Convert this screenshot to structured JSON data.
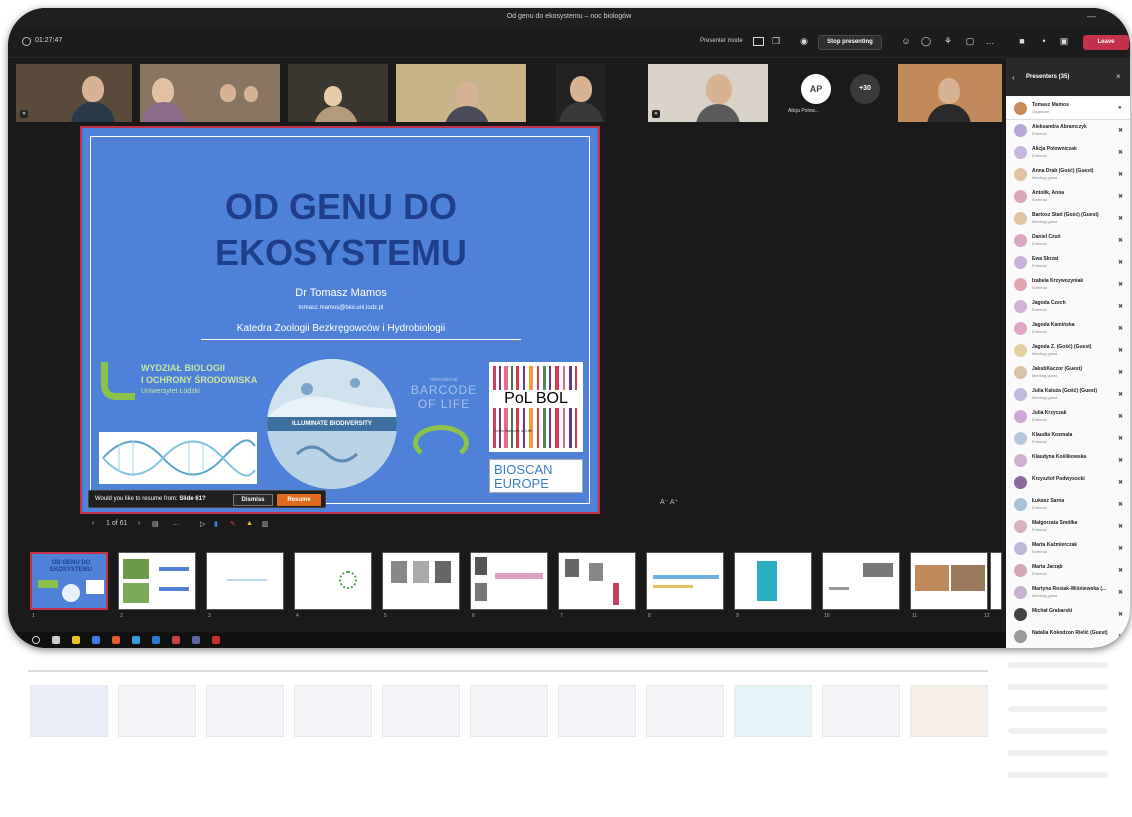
{
  "window": {
    "title": "Od genu do ekosystemu – noc biologów",
    "minimize": "—"
  },
  "toolbar": {
    "timer": "01:27:47",
    "presenter_mode": "Presenter mode",
    "stop_presenting": "Stop presenting",
    "leave": "Leave",
    "more": "…"
  },
  "participants": {
    "avatar_initials": "AP",
    "avatar_name": "Alicja Polow...",
    "more_count": "+30"
  },
  "slide": {
    "title_line1": "OD GENU DO",
    "title_line2": "EKOSYSTEMU",
    "author": "Dr Tomasz Mamos",
    "email": "tomasz.mamos@biol.uni.lodz.pl",
    "department": "Katedra Zoologii Bezkręgowców i Hydrobiologii",
    "faculty_line1": "WYDZIAŁ BIOLOGII",
    "faculty_line2": "I OCHRONY ŚRODOWISKA",
    "university": "Uniwersytet Łódzki",
    "illuminate": "ILLUMINATE BIODIVERSITY",
    "barcode_small": "international",
    "barcode_line1": "BARCODE",
    "barcode_line2": "OF LIFE",
    "polbol": "PoL BOL",
    "polbol_sub": "Polish Barcode of Life",
    "bioscan_line1": "BIOSCAN",
    "bioscan_line2": "EUROPE"
  },
  "resume": {
    "message_prefix": "Would you like to resume from:",
    "message_slide": "Slide 61?",
    "dismiss": "Dismiss",
    "resume": "Resume"
  },
  "slide_controls": {
    "prev": "‹",
    "counter": "1 of 61",
    "next": "›",
    "zoom": "A⁻  A⁺"
  },
  "thumbnails": [
    {
      "num": "1",
      "title": "OD GENU DO EKOSYSTEMU"
    },
    {
      "num": "2",
      "title": ""
    },
    {
      "num": "3",
      "title": ""
    },
    {
      "num": "4",
      "title": ""
    },
    {
      "num": "5",
      "title": ""
    },
    {
      "num": "6",
      "title": ""
    },
    {
      "num": "7",
      "title": ""
    },
    {
      "num": "8",
      "title": ""
    },
    {
      "num": "9",
      "title": ""
    },
    {
      "num": "10",
      "title": ""
    },
    {
      "num": "11",
      "title": ""
    },
    {
      "num": "12",
      "title": ""
    }
  ],
  "panel": {
    "title": "Presenters (35)",
    "back": "‹",
    "close": "×",
    "people": [
      {
        "name": "Tomasz Mamos",
        "role": "Organizer",
        "color": "#c98a5a"
      },
      {
        "name": "Aleksandra Abramczyk",
        "role": "External",
        "color": "#b8a7d9"
      },
      {
        "name": "Alicja Polowniczak",
        "role": "External",
        "color": "#c6b7e0"
      },
      {
        "name": "Anna Drab (Gość) (Guest)",
        "role": "Meeting guest",
        "color": "#e0c3a1"
      },
      {
        "name": "Antolik, Anna",
        "role": "External",
        "color": "#d9a7b8"
      },
      {
        "name": "Bartosz Stań (Gość) (Guest)",
        "role": "Meeting guest",
        "color": "#e3c4a0"
      },
      {
        "name": "Daniel Czuń",
        "role": "External",
        "color": "#d9a7c0"
      },
      {
        "name": "Ewa Skrzat",
        "role": "External",
        "color": "#c9b2d9"
      },
      {
        "name": "Izabela Krzywozyniak",
        "role": "External",
        "color": "#e0a7b0"
      },
      {
        "name": "Jagoda Czech",
        "role": "External",
        "color": "#d1b2d9"
      },
      {
        "name": "Jagoda Kamińska",
        "role": "External",
        "color": "#e0a7c5"
      },
      {
        "name": "Jagoda Z. (Gość) (Guest)",
        "role": "Meeting guest",
        "color": "#e6cfa0"
      },
      {
        "name": "JakubKaczor (Guest)",
        "role": "Meeting guest",
        "color": "#d9c2a5"
      },
      {
        "name": "Julia Kaluża (Gość) (Guest)",
        "role": "Meeting guest",
        "color": "#c2b8e0"
      },
      {
        "name": "Julia Krzyczak",
        "role": "External",
        "color": "#d1a7d9"
      },
      {
        "name": "Klaudia Kosmala",
        "role": "External",
        "color": "#b8c7e0"
      },
      {
        "name": "Klaudyna Koślikowska",
        "role": "",
        "color": "#cfb0cf"
      },
      {
        "name": "Krzysztof Podwysocki",
        "role": "",
        "color": "#8a6a9e"
      },
      {
        "name": "Łukasz Sarna",
        "role": "External",
        "color": "#a7c3d9"
      },
      {
        "name": "Małgorzata Smółka",
        "role": "External",
        "color": "#d9b2c2"
      },
      {
        "name": "Marta Kaźmierczak",
        "role": "External",
        "color": "#c0b8d9"
      },
      {
        "name": "Marta Jarząb",
        "role": "External",
        "color": "#d6a7b6"
      },
      {
        "name": "Martyna Rosiak-Wiśniewska (...",
        "role": "Meeting guest",
        "color": "#c9b2d1"
      },
      {
        "name": "Michał Grabarski",
        "role": "",
        "color": "#444444"
      },
      {
        "name": "Natalia Kokodzon Rielić (Guest)",
        "role": "",
        "color": "#9a9a9a"
      }
    ]
  },
  "colors": {
    "accent_red": "#c4314b",
    "resume_orange": "#e06a1f",
    "slide_blue": "#4f81d9",
    "title_blue": "#1f3f8c",
    "green": "#8bc34a"
  }
}
